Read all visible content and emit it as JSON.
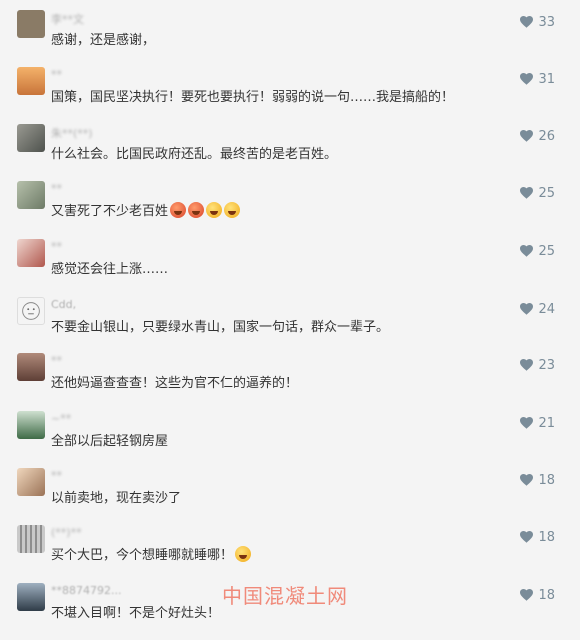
{
  "comments": [
    {
      "nickname": "李**文",
      "text": "感谢，还是感谢，",
      "likes": "33",
      "avatar_color": "#8a7b66",
      "emoji": []
    },
    {
      "nickname": "**",
      "text": "国策，国民坚决执行！要死也要执行！弱弱的说一句……我是搞船的！",
      "likes": "31",
      "avatar_color": "#d48a4a",
      "emoji": []
    },
    {
      "nickname": "朱**(**)",
      "text": "什么社会。比国民政府还乱。最终苦的是老百姓。",
      "likes": "26",
      "avatar_color": "#6d6f6a",
      "emoji": []
    },
    {
      "nickname": "**",
      "text": "又害死了不少老百姓",
      "likes": "25",
      "avatar_color": "#8f9a86",
      "emoji": [
        "angry",
        "angry",
        "laugh",
        "laugh"
      ]
    },
    {
      "nickname": "**",
      "text": "感觉还会往上涨……",
      "likes": "25",
      "avatar_color": "#c9a6a0",
      "emoji": []
    },
    {
      "nickname": "Cdd,",
      "text": "不要金山银山，只要绿水青山，国家一句话，群众一辈子。",
      "likes": "24",
      "avatar_color": "#e8e8e8",
      "emoji": []
    },
    {
      "nickname": "**",
      "text": "还他妈逼查查查！这些为官不仁的逼养的！",
      "likes": "23",
      "avatar_color": "#8c6a5e",
      "emoji": []
    },
    {
      "nickname": "~**",
      "text": "全部以后起轻钢房屋",
      "likes": "21",
      "avatar_color": "#5d7f63",
      "emoji": []
    },
    {
      "nickname": "**",
      "text": "以前卖地，现在卖沙了",
      "likes": "18",
      "avatar_color": "#c7a487",
      "emoji": []
    },
    {
      "nickname": "(**)**",
      "text": "买个大巴，今个想睡哪就睡哪！",
      "likes": "18",
      "avatar_color": "#9b9b9b",
      "emoji": [
        "laugh"
      ]
    },
    {
      "nickname": "**8874792...",
      "text": "不堪入目啊！不是个好灶头！",
      "likes": "18",
      "avatar_color": "#4f5e6e",
      "emoji": []
    }
  ],
  "watermark": "中国混凝土网",
  "colors": {
    "heart": "#7a8c99",
    "text": "#333333",
    "watermark": "#f08a7a"
  }
}
